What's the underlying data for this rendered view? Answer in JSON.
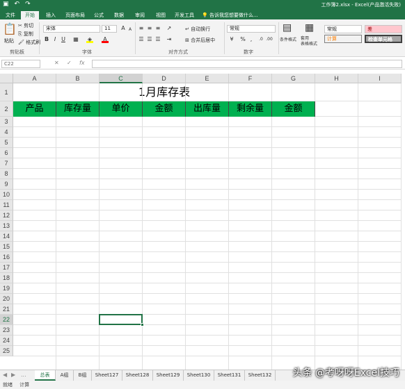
{
  "titlebar": {
    "title": "工作簿2.xlsx - Excel(产品激活失败)",
    "save_icon": "save-icon",
    "undo": "↶",
    "redo": "↷"
  },
  "tabs": [
    "文件",
    "开始",
    "插入",
    "页面布局",
    "公式",
    "数据",
    "审阅",
    "视图",
    "开发工具"
  ],
  "active_tab": "开始",
  "tell_me": "告诉我您想要做什么...",
  "ribbon": {
    "clipboard": {
      "paste": "粘贴",
      "cut": "剪切",
      "copy": "复制",
      "format_painter": "格式刷",
      "label": "剪贴板"
    },
    "font": {
      "name": "宋体",
      "size": "11",
      "grow": "A",
      "shrink": "A",
      "bold": "B",
      "italic": "I",
      "underline": "U",
      "label": "字体",
      "fill_color": "#ffff00",
      "font_color": "#ff0000"
    },
    "alignment": {
      "wrap": "自动换行",
      "merge": "合并后居中",
      "label": "对齐方式"
    },
    "number": {
      "format": "常规",
      "percent": "%",
      "comma": ",",
      "label": "数字"
    },
    "styles": {
      "conditional": "条件格式",
      "table": "套用\n表格格式",
      "normal": "常规",
      "bad": "差",
      "calc": "计算",
      "check": "检查单元格"
    }
  },
  "formula_bar": {
    "name_box": "C22",
    "cancel": "✕",
    "enter": "✓",
    "fx": "fx",
    "value": ""
  },
  "columns": [
    "A",
    "B",
    "C",
    "D",
    "E",
    "F",
    "G",
    "H",
    "I"
  ],
  "rows": [
    "1",
    "2",
    "3",
    "4",
    "5",
    "6",
    "7",
    "8",
    "9",
    "10",
    "11",
    "12",
    "13",
    "14",
    "15",
    "16",
    "17",
    "18",
    "19",
    "20",
    "21",
    "22",
    "23",
    "24",
    "25"
  ],
  "selected_cell": {
    "column": "C",
    "row": "22"
  },
  "sheet_title": "1月库存表",
  "headers": [
    "产品",
    "库存量",
    "单价",
    "金额",
    "出库量",
    "剩余量",
    "金额"
  ],
  "header_fill": "#00b050",
  "sheet_tabs": [
    "总表",
    "A组",
    "B组",
    "Sheet127",
    "Sheet128",
    "Sheet129",
    "Sheet130",
    "Sheet131",
    "Sheet132"
  ],
  "active_sheet": "总表",
  "sheet_nav": [
    "◀",
    "▶",
    "..."
  ],
  "status": {
    "ready": "就绪",
    "calc": "计算"
  },
  "watermark": "头条 @考呀呀Excel技巧"
}
